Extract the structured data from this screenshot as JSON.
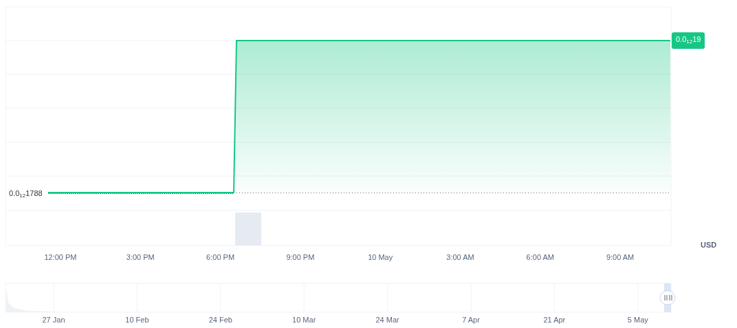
{
  "chart": {
    "price_labels": [
      {
        "kind": "current",
        "text": "0.0$_{12}$19"
      },
      {
        "kind": "open",
        "text": "0.0$_{12}$1788"
      }
    ],
    "currency": "USD",
    "x_axis_labels": [
      "12:00 PM",
      "3:00 PM",
      "6:00 PM",
      "9:00 PM",
      "10 May",
      "3:00 AM",
      "6:00 AM",
      "9:00 AM"
    ],
    "navigator": {
      "labels": [
        "27 Jan",
        "10 Feb",
        "24 Feb",
        "10 Mar",
        "24 Mar",
        "7 Apr",
        "21 Apr",
        "5 May"
      ]
    }
  }
}
